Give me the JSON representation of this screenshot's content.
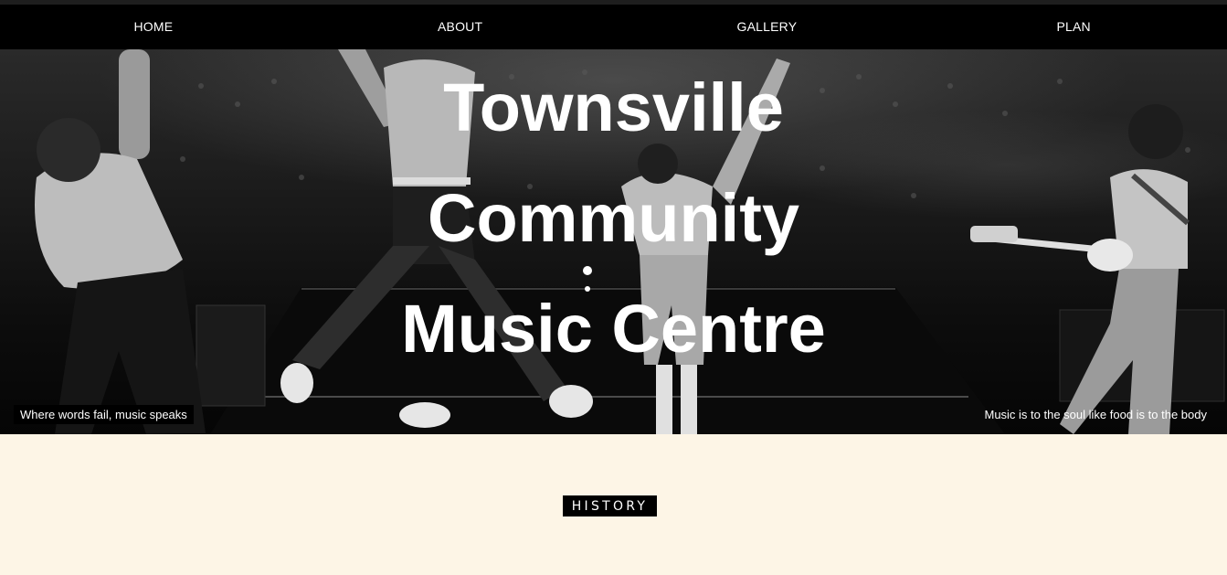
{
  "nav": {
    "items": [
      {
        "label": "HOME"
      },
      {
        "label": "ABOUT"
      },
      {
        "label": "GALLERY"
      },
      {
        "label": "PLAN"
      }
    ]
  },
  "hero": {
    "title_lines": [
      "Townsville",
      "Community",
      "Music Centre"
    ],
    "quote_left": "Where words fail, music speaks",
    "quote_right": "Music is to the soul like food is to the body",
    "image": "concert-stage-photo"
  },
  "section": {
    "heading": "HISTORY"
  },
  "colors": {
    "nav_bg": "#000000",
    "page_bg": "#fdf5e6",
    "text_light": "#ffffff"
  }
}
